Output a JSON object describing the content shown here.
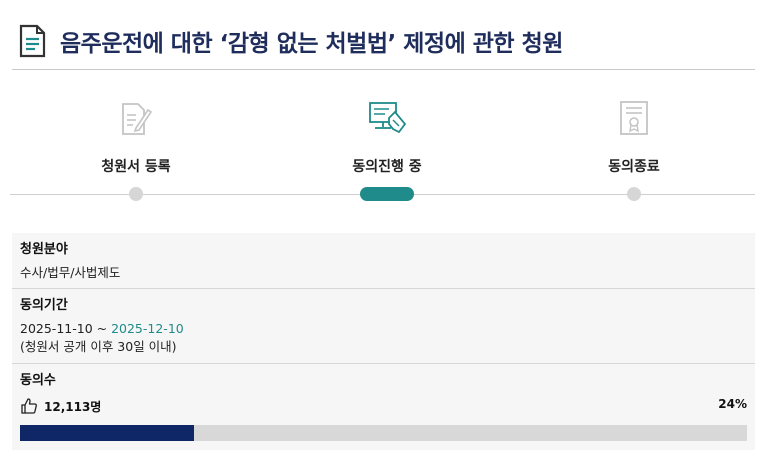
{
  "title": "음주운전에 대한 ‘감형 없는 처벌법’ 제정에 관한 청원",
  "steps": [
    {
      "label": "청원서 등록",
      "icon": "document-pen-icon",
      "state": "done"
    },
    {
      "label": "동의진행 중",
      "icon": "computer-hand-icon",
      "state": "active"
    },
    {
      "label": "동의종료",
      "icon": "certificate-icon",
      "state": "pending"
    }
  ],
  "colors": {
    "accent": "#1f8b8a",
    "title": "#1f2d5c",
    "progress": "#0f2767"
  },
  "field": {
    "label": "청원분야",
    "value": "수사/법무/사법제도"
  },
  "period": {
    "label": "동의기간",
    "start": "2025-11-10",
    "separator": " ~ ",
    "end": "2025-12-10",
    "note": "(청원서 공개 이후 30일 이내)"
  },
  "consent": {
    "label": "동의수",
    "count": "12,113명",
    "percent_text": "24%",
    "progress": 0.24
  }
}
